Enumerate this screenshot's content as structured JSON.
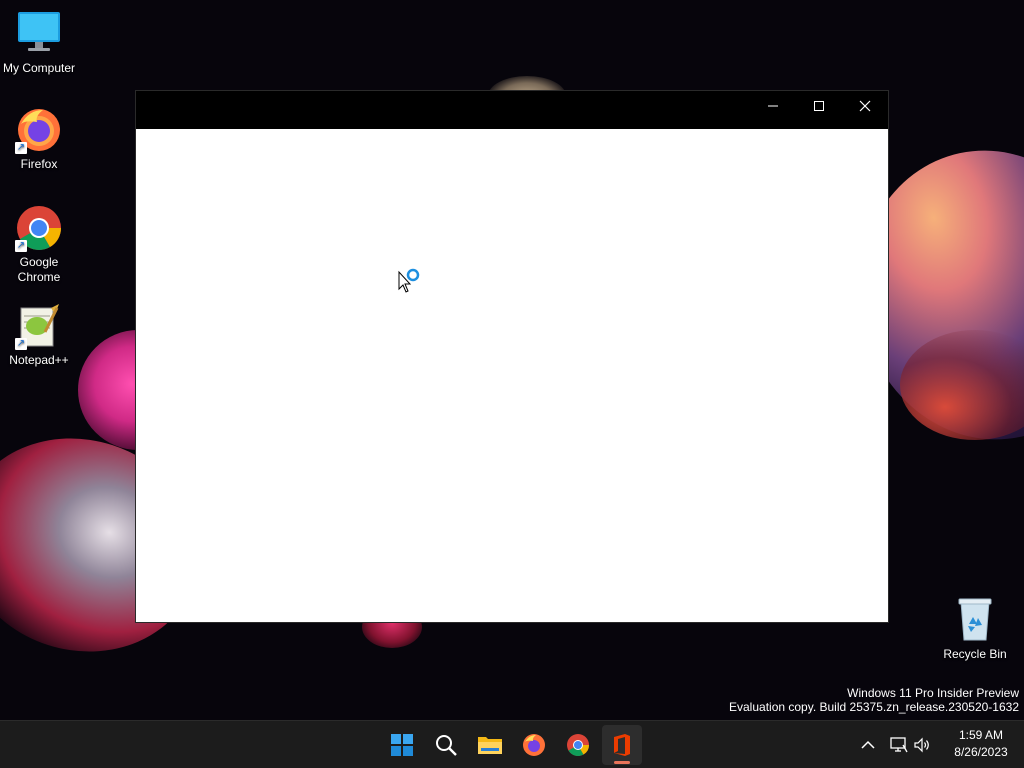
{
  "desktop": {
    "icons": [
      {
        "label": "My Computer"
      },
      {
        "label": "Firefox"
      },
      {
        "label": "Google Chrome"
      },
      {
        "label": "Notepad++"
      },
      {
        "label": "Recycle Bin"
      }
    ],
    "watermark": {
      "line1": "Windows 11 Pro Insider Preview",
      "line2": "Evaluation copy. Build 25375.zn_release.230520-1632"
    }
  },
  "window": {
    "title": "",
    "controls": [
      "minimize-icon",
      "maximize-icon",
      "close-icon"
    ]
  },
  "taskbar": {
    "apps": [
      "windows-start-icon",
      "search-icon",
      "file-explorer-icon",
      "firefox-icon",
      "chrome-icon",
      "office-icon"
    ],
    "active_app": "office-icon",
    "tray_icons": [
      "chevron-up-icon",
      "network-icon",
      "volume-icon"
    ],
    "clock": {
      "time": "1:59 AM",
      "date": "8/26/2023"
    }
  },
  "colors": {
    "taskbar_bg": "#1c1c1c",
    "titlebar_bg": "#000000",
    "accent": "#0a84d8"
  }
}
